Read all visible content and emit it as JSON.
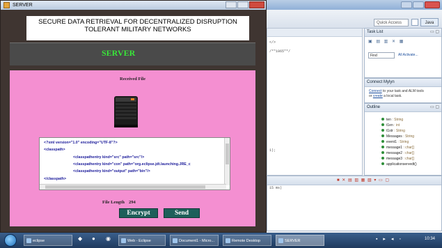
{
  "eclipse": {
    "quick_access": "Quick Access",
    "perspective": "Java",
    "editor_lines": [
      "</>",
      "/*\"1065\"*/",
      "1);",
      "15 ms)"
    ],
    "task_list": {
      "title": "Task List",
      "find_placeholder": "Find",
      "links": "All  Activate..."
    },
    "mylyn": {
      "title": "Connect Mylyn",
      "line1_link": "Connect",
      "line1_rest": " to your task and ALM tools",
      "line2_pre": "or ",
      "line2_link": "create",
      "line2_rest": " a local task."
    },
    "outline": {
      "title": "Outline",
      "items": [
        {
          "name": "ten",
          "type": ": String"
        },
        {
          "name": "t1en",
          "type": ": int"
        },
        {
          "name": "t1str",
          "type": ": String"
        },
        {
          "name": "Messages",
          "type": ": String"
        },
        {
          "name": "event1",
          "type": ": String"
        },
        {
          "name": "message1",
          "type": ": char[]"
        },
        {
          "name": "message2",
          "type": ": char[]"
        },
        {
          "name": "message3",
          "type": ": char[]"
        },
        {
          "name": "applicationservedt()",
          "type": ""
        }
      ]
    }
  },
  "server_window": {
    "title": "SERVER",
    "banner_line1": "SECURE DATA RETRIEVAL FOR DECENTRALIZED DISRUPTION",
    "banner_line2": "TOLERANT MILITARY NETWORKS",
    "server_label": "SERVER",
    "received_title": "Received File",
    "xml_lines": [
      "<?xml version=\"1.0\" encoding=\"UTF-8\"?>",
      "<classpath>",
      "<classpathentry kind=\"src\" path=\"src\"/>",
      "<classpathentry kind=\"con\" path=\"org.eclipse.jdt.launching.JRE_c",
      "<classpathentry kind=\"output\" path=\"bin\"/>",
      "</classpath>"
    ],
    "file_length_label": "File Length",
    "file_length_value": "294",
    "encrypt_label": "Encrypt",
    "send_label": "Send"
  },
  "taskbar": {
    "items": [
      {
        "label": "eclipse"
      },
      {
        "label": "Web - Eclipse"
      },
      {
        "label": "Document1 - Micro..."
      },
      {
        "label": "Remote Desktop"
      },
      {
        "label": "SERVER"
      }
    ],
    "clock": "10:34"
  },
  "colors": {
    "pink_panel": "#f48fd1",
    "server_label": "#39e639",
    "button": "#1e5f5a",
    "window_frame": "#3f3531"
  }
}
